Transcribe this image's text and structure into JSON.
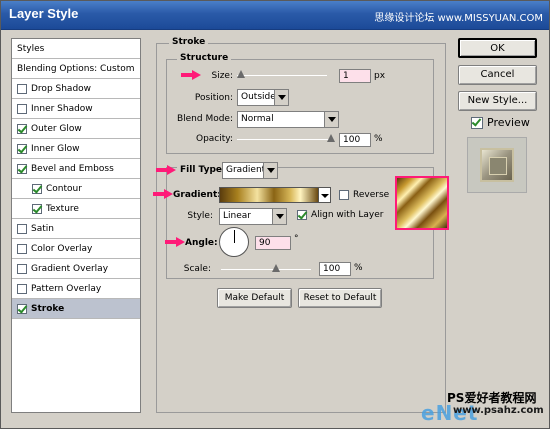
{
  "window": {
    "title": "Layer Style",
    "watermark_top": "思缘设计论坛 www.MISSYUAN.COM"
  },
  "styles_panel": {
    "items": [
      {
        "label": "Styles",
        "checkbox": false,
        "checked": false,
        "sub": false,
        "selected": false
      },
      {
        "label": "Blending Options: Custom",
        "checkbox": false,
        "checked": false,
        "sub": false,
        "selected": false
      },
      {
        "label": "Drop Shadow",
        "checkbox": true,
        "checked": false,
        "sub": false,
        "selected": false
      },
      {
        "label": "Inner Shadow",
        "checkbox": true,
        "checked": false,
        "sub": false,
        "selected": false
      },
      {
        "label": "Outer Glow",
        "checkbox": true,
        "checked": true,
        "sub": false,
        "selected": false
      },
      {
        "label": "Inner Glow",
        "checkbox": true,
        "checked": true,
        "sub": false,
        "selected": false
      },
      {
        "label": "Bevel and Emboss",
        "checkbox": true,
        "checked": true,
        "sub": false,
        "selected": false
      },
      {
        "label": "Contour",
        "checkbox": true,
        "checked": true,
        "sub": true,
        "selected": false
      },
      {
        "label": "Texture",
        "checkbox": true,
        "checked": true,
        "sub": true,
        "selected": false
      },
      {
        "label": "Satin",
        "checkbox": true,
        "checked": false,
        "sub": false,
        "selected": false
      },
      {
        "label": "Color Overlay",
        "checkbox": true,
        "checked": false,
        "sub": false,
        "selected": false
      },
      {
        "label": "Gradient Overlay",
        "checkbox": true,
        "checked": false,
        "sub": false,
        "selected": false
      },
      {
        "label": "Pattern Overlay",
        "checkbox": true,
        "checked": false,
        "sub": false,
        "selected": false
      },
      {
        "label": "Stroke",
        "checkbox": true,
        "checked": true,
        "sub": false,
        "selected": true
      }
    ]
  },
  "stroke": {
    "section_title": "Stroke",
    "structure_title": "Structure",
    "size_label": "Size:",
    "size_value": "1",
    "size_unit": "px",
    "position_label": "Position:",
    "position_value": "Outside",
    "blend_mode_label": "Blend Mode:",
    "blend_mode_value": "Normal",
    "opacity_label": "Opacity:",
    "opacity_value": "100",
    "opacity_unit": "%",
    "fill_type_label": "Fill Type:",
    "fill_type_value": "Gradient",
    "gradient_label": "Gradient:",
    "reverse_label": "Reverse",
    "reverse_checked": false,
    "style_label": "Style:",
    "style_value": "Linear",
    "align_label": "Align with Layer",
    "align_checked": true,
    "angle_label": "Angle:",
    "angle_value": "90",
    "angle_unit": "°",
    "scale_label": "Scale:",
    "scale_value": "100",
    "scale_unit": "%",
    "make_default_label": "Make Default",
    "reset_default_label": "Reset to Default"
  },
  "actions": {
    "ok_label": "OK",
    "cancel_label": "Cancel",
    "new_style_label": "New Style...",
    "preview_label": "Preview",
    "preview_checked": true
  },
  "watermark_bottom": {
    "line1": "PS爱好者教程网",
    "line2": "www.psahz.com",
    "logo": "eNet"
  },
  "colors": {
    "titlebar": "#2a5aa8",
    "panel": "#d4d0c8",
    "highlight_arrow": "#ff1a78"
  }
}
